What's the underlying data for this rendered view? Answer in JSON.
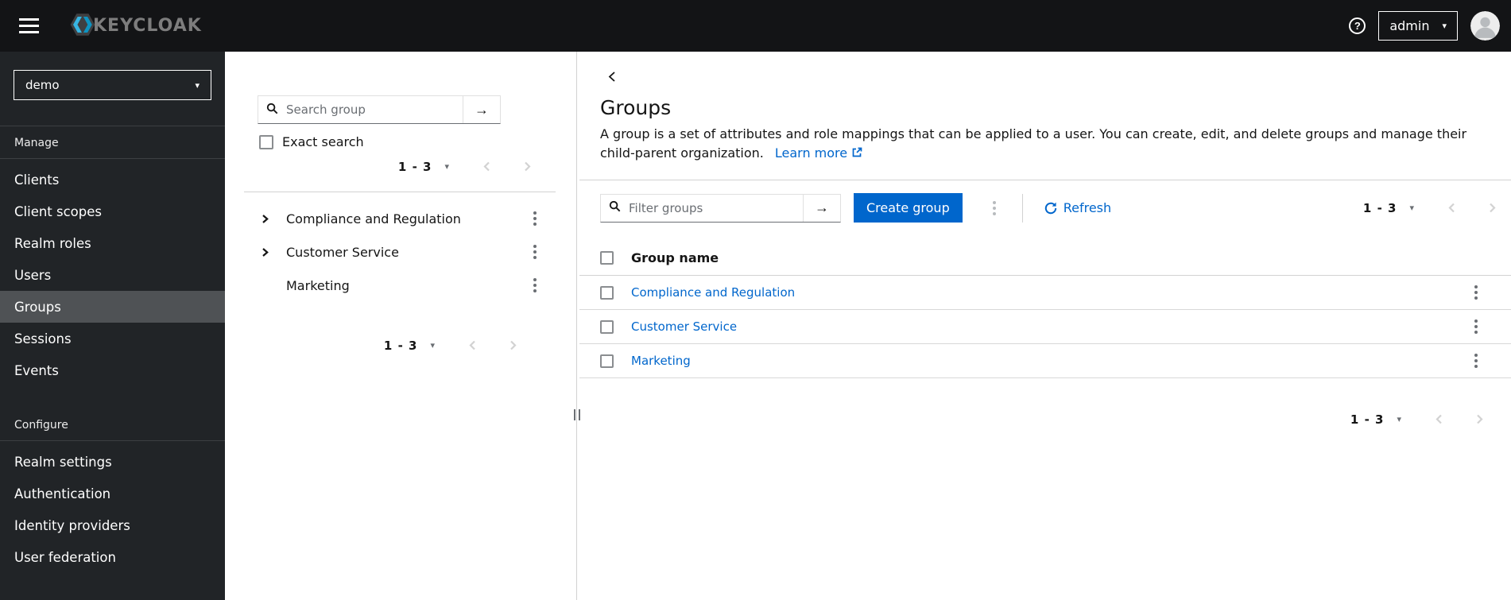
{
  "masthead": {
    "logo_text": "KEYCLOAK",
    "user_menu_label": "admin"
  },
  "icons": {
    "question": "?",
    "caret_down": "▾",
    "arrow_right": "→"
  },
  "sidebar": {
    "realm_selector_value": "demo",
    "sections": [
      {
        "label": "Manage",
        "items": [
          {
            "label": "Clients",
            "selected": false
          },
          {
            "label": "Client scopes",
            "selected": false
          },
          {
            "label": "Realm roles",
            "selected": false
          },
          {
            "label": "Users",
            "selected": false
          },
          {
            "label": "Groups",
            "selected": true
          },
          {
            "label": "Sessions",
            "selected": false
          },
          {
            "label": "Events",
            "selected": false
          }
        ]
      },
      {
        "label": "Configure",
        "items": [
          {
            "label": "Realm settings",
            "selected": false
          },
          {
            "label": "Authentication",
            "selected": false
          },
          {
            "label": "Identity providers",
            "selected": false
          },
          {
            "label": "User federation",
            "selected": false
          }
        ]
      }
    ]
  },
  "tree_panel": {
    "search_placeholder": "Search group",
    "exact_search_label": "Exact search",
    "top_pagination_range": "1 - 3",
    "items": [
      {
        "label": "Compliance and Regulation",
        "expandable": true
      },
      {
        "label": "Customer Service",
        "expandable": true
      },
      {
        "label": "Marketing",
        "expandable": false
      }
    ],
    "bottom_pagination_range": "1 - 3"
  },
  "main": {
    "title": "Groups",
    "description": "A group is a set of attributes and role mappings that can be applied to a user. You can create, edit, and delete groups and manage their child-parent organization.",
    "learn_more_label": "Learn more",
    "toolbar": {
      "filter_placeholder": "Filter groups",
      "create_button_label": "Create group",
      "refresh_label": "Refresh",
      "pagination_range": "1 - 3"
    },
    "table": {
      "column_header": "Group name",
      "rows": [
        {
          "name": "Compliance and Regulation"
        },
        {
          "name": "Customer Service"
        },
        {
          "name": "Marketing"
        }
      ]
    },
    "bottom_pagination_range": "1 - 3"
  },
  "colors": {
    "accent_blue": "#0066cc",
    "link_blue": "#0066cc",
    "masthead_bg": "#131416",
    "sidebar_bg": "#212427",
    "sidebar_selected_bg": "#4f5255"
  }
}
